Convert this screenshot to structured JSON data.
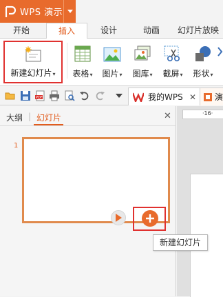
{
  "app": {
    "name": "WPS 演示"
  },
  "ribbon_tabs": [
    "开始",
    "插入",
    "设计",
    "动画",
    "幻灯片放映"
  ],
  "active_tab": "插入",
  "ribbon": {
    "new_slide_label": "新建幻灯片",
    "table_label": "表格",
    "picture_label": "图片",
    "gallery_label": "图库",
    "screenshot_label": "截屏",
    "shape_label": "形状"
  },
  "doc_tabs": {
    "mywps_label": "我的WPS",
    "doc2_label": "演"
  },
  "panel": {
    "tab_outline": "大纲",
    "tab_separator": "|",
    "tab_slides": "幻灯片",
    "slide_number": "1"
  },
  "ruler": {
    "label": "·16·"
  },
  "tooltip": {
    "text": "新建幻灯片"
  },
  "colors": {
    "accent": "#e86b2c",
    "highlight_box": "#e0312f"
  },
  "icons": {
    "app_logo": "wps-p-logo",
    "new_slide": "new-slide-icon",
    "table": "table-icon",
    "picture": "picture-icon",
    "gallery": "gallery-icon",
    "screenshot": "scissors-icon",
    "shape": "shape-icon",
    "play": "play-icon",
    "add": "plus-icon"
  }
}
